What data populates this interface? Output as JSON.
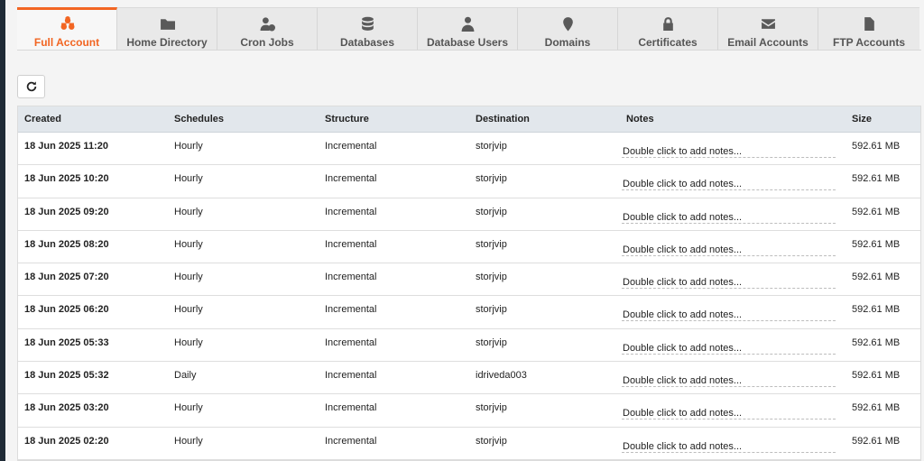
{
  "tabs": [
    {
      "label": "Full Account",
      "icon": "cubes-icon",
      "active": true
    },
    {
      "label": "Home Directory",
      "icon": "folder-icon",
      "active": false
    },
    {
      "label": "Cron Jobs",
      "icon": "user-clock-icon",
      "active": false
    },
    {
      "label": "Databases",
      "icon": "database-icon",
      "active": false
    },
    {
      "label": "Database Users",
      "icon": "user-tie-icon",
      "active": false
    },
    {
      "label": "Domains",
      "icon": "map-marker-icon",
      "active": false
    },
    {
      "label": "Certificates",
      "icon": "lock-icon",
      "active": false
    },
    {
      "label": "Email Accounts",
      "icon": "envelope-icon",
      "active": false
    },
    {
      "label": "FTP Accounts",
      "icon": "file-icon",
      "active": false
    }
  ],
  "refresh": {
    "icon": "refresh-icon"
  },
  "table": {
    "headers": [
      "Created",
      "Schedules",
      "Structure",
      "Destination",
      "Notes",
      "Size"
    ],
    "rows": [
      {
        "created": "18 Jun 2025 11:20",
        "schedule": "Hourly",
        "structure": "Incremental",
        "destination": "storjvip",
        "notes": "Double click to add notes...",
        "size": "592.61 MB"
      },
      {
        "created": "18 Jun 2025 10:20",
        "schedule": "Hourly",
        "structure": "Incremental",
        "destination": "storjvip",
        "notes": "Double click to add notes...",
        "size": "592.61 MB"
      },
      {
        "created": "18 Jun 2025 09:20",
        "schedule": "Hourly",
        "structure": "Incremental",
        "destination": "storjvip",
        "notes": "Double click to add notes...",
        "size": "592.61 MB"
      },
      {
        "created": "18 Jun 2025 08:20",
        "schedule": "Hourly",
        "structure": "Incremental",
        "destination": "storjvip",
        "notes": "Double click to add notes...",
        "size": "592.61 MB"
      },
      {
        "created": "18 Jun 2025 07:20",
        "schedule": "Hourly",
        "structure": "Incremental",
        "destination": "storjvip",
        "notes": "Double click to add notes...",
        "size": "592.61 MB"
      },
      {
        "created": "18 Jun 2025 06:20",
        "schedule": "Hourly",
        "structure": "Incremental",
        "destination": "storjvip",
        "notes": "Double click to add notes...",
        "size": "592.61 MB"
      },
      {
        "created": "18 Jun 2025 05:33",
        "schedule": "Hourly",
        "structure": "Incremental",
        "destination": "storjvip",
        "notes": "Double click to add notes...",
        "size": "592.61 MB"
      },
      {
        "created": "18 Jun 2025 05:32",
        "schedule": "Daily",
        "structure": "Incremental",
        "destination": "idriveda003",
        "notes": "Double click to add notes...",
        "size": "592.61 MB"
      },
      {
        "created": "18 Jun 2025 03:20",
        "schedule": "Hourly",
        "structure": "Incremental",
        "destination": "storjvip",
        "notes": "Double click to add notes...",
        "size": "592.61 MB"
      },
      {
        "created": "18 Jun 2025 02:20",
        "schedule": "Hourly",
        "structure": "Incremental",
        "destination": "storjvip",
        "notes": "Double click to add notes...",
        "size": "592.61 MB"
      }
    ]
  },
  "colors": {
    "accent": "#f26522",
    "header_bg": "#e2e7ec"
  }
}
